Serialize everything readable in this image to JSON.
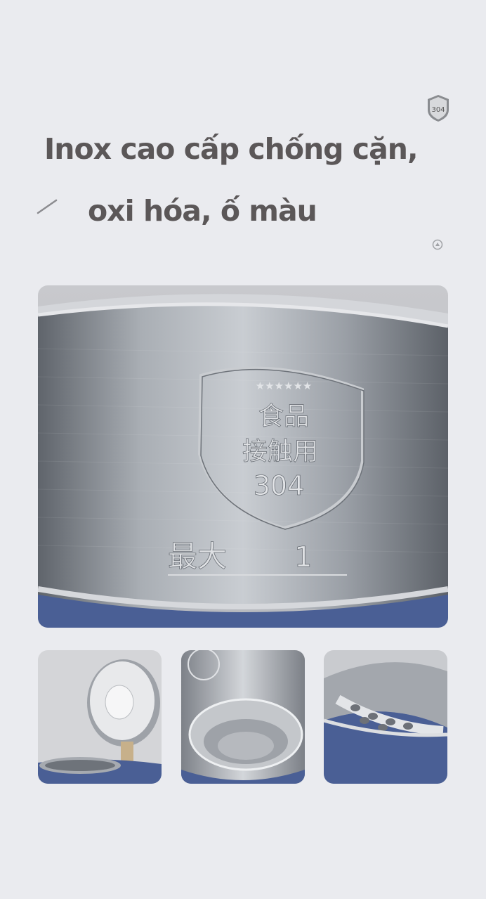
{
  "headline": {
    "line1": "Inox cao cấp chống cặn,",
    "line2": "oxi hóa, ố màu"
  },
  "badge": {
    "label": "304",
    "icon": "shield-304-icon"
  },
  "decor": {
    "slash_icon": "slash-icon",
    "dot_icon": "circle-dot-icon"
  },
  "main_photo": {
    "emboss_stars": "★★★★★★",
    "emboss_line1": "食品",
    "emboss_line2": "接触用",
    "emboss_grade": "304",
    "max_mark": "最大",
    "max_level": "1"
  },
  "thumbnails": [
    {
      "subject": "open-lid-kettle"
    },
    {
      "subject": "inner-pot"
    },
    {
      "subject": "spout-filter"
    }
  ],
  "colors": {
    "background": "#eaebef",
    "headline": "#5b5758",
    "kettle_blue": "#4a5f95",
    "steel": "#9a9fa6"
  }
}
